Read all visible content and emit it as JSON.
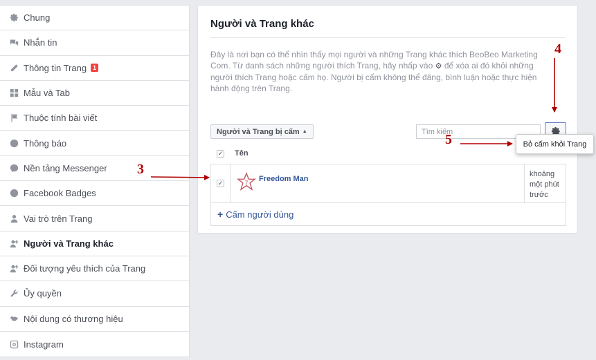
{
  "sidebar": {
    "items": [
      {
        "label": "Chung",
        "icon": "gear-icon"
      },
      {
        "label": "Nhắn tin",
        "icon": "messages-icon"
      },
      {
        "label": "Thông tin Trang",
        "icon": "pencil-icon",
        "badge": "1"
      },
      {
        "label": "Mẫu và Tab",
        "icon": "grid-icon"
      },
      {
        "label": "Thuộc tính bài viết",
        "icon": "flag-icon"
      },
      {
        "label": "Thông báo",
        "icon": "globe-icon"
      },
      {
        "label": "Nền tảng Messenger",
        "icon": "messenger-icon"
      },
      {
        "label": "Facebook Badges",
        "icon": "badge-icon"
      },
      {
        "label": "Vai trò trên Trang",
        "icon": "person-icon"
      },
      {
        "label": "Người và Trang khác",
        "icon": "people-icon",
        "active": true
      },
      {
        "label": "Đối tượng yêu thích của Trang",
        "icon": "people-add-icon"
      },
      {
        "label": "Ủy quyền",
        "icon": "wrench-icon"
      },
      {
        "label": "Nội dung có thương hiệu",
        "icon": "handshake-icon"
      },
      {
        "label": "Instagram",
        "icon": "instagram-icon"
      }
    ]
  },
  "main": {
    "title": "Người và Trang khác",
    "description_part1": "Đây là nơi bạn có thể nhìn thấy mọi người và những Trang khác thích BeoBeo Marketing Com. Từ danh sách những người thích Trang, hãy nhấp vào ",
    "description_part2": " để xóa ai đó khỏi những người thích Trang hoặc cấm họ. Người bị cấm không thể đăng, bình luận hoặc thực hiện hành động trên Trang.",
    "filter_label": "Người và Trang bị cấm",
    "search_placeholder": "Tìm kiếm",
    "tooltip": "Bỏ cấm khỏi Trang",
    "table": {
      "col_name": "Tên",
      "rows": [
        {
          "name": "Freedom Man",
          "time": "khoảng một phút trước",
          "checked": true
        }
      ]
    },
    "add_label": "Cấm người dùng"
  },
  "annotations": {
    "n3": "3",
    "n4": "4",
    "n5": "5"
  },
  "colors": {
    "annotation": "#b00000",
    "link": "#365899",
    "badge": "#fa3e3e"
  }
}
